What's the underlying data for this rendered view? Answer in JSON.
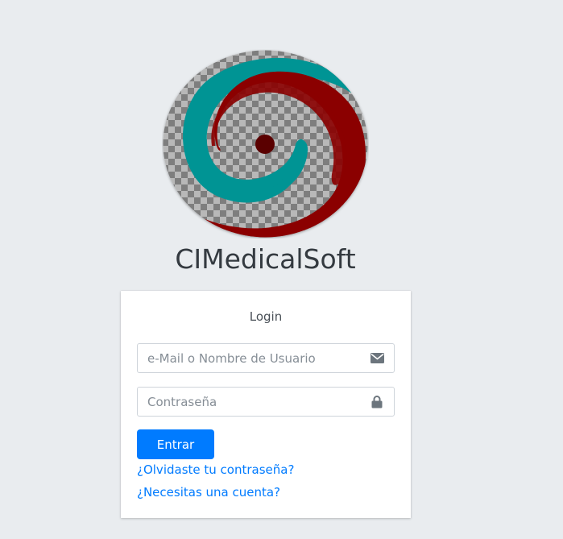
{
  "brand": {
    "name": "CIMedicalSoft"
  },
  "login": {
    "title": "Login",
    "email_placeholder": "e-Mail o Nombre de Usuario",
    "password_placeholder": "Contraseña",
    "submit_label": "Entrar",
    "forgot_link": "¿Olvidaste tu contraseña?",
    "register_link": "¿Necesitas una cuenta?"
  },
  "icons": {
    "email": "envelope-icon",
    "password": "lock-icon"
  },
  "colors": {
    "background": "#e9ecef",
    "primary": "#007bff",
    "logo_teal": "#009494",
    "logo_red": "#8b0000"
  }
}
